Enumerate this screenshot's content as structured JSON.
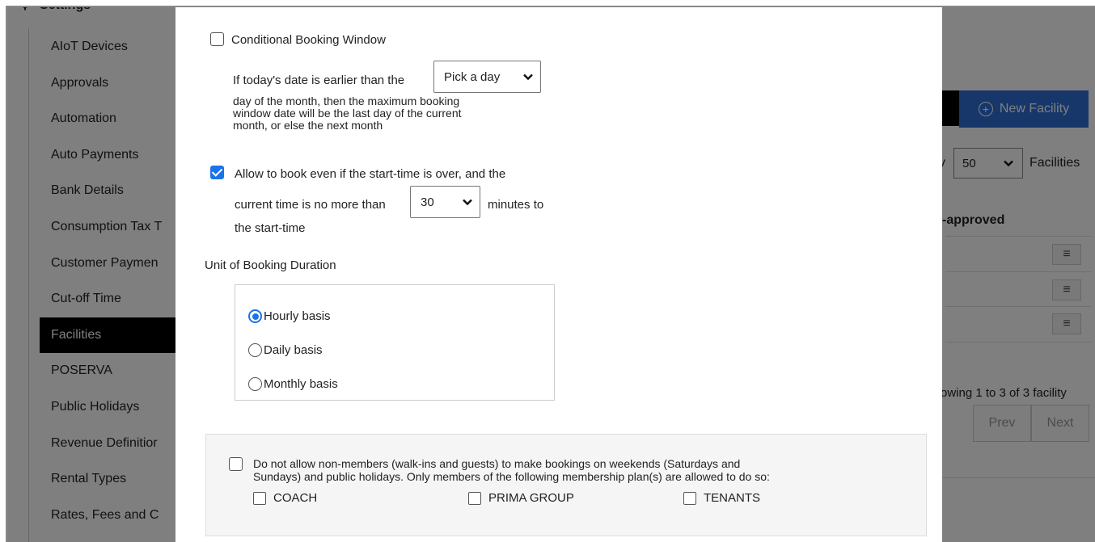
{
  "background": {
    "settings_title": "Settings",
    "sidebar": {
      "active_index": 8,
      "items": [
        {
          "label": "AIoT Devices"
        },
        {
          "label": "Approvals"
        },
        {
          "label": "Automation"
        },
        {
          "label": "Auto Payments"
        },
        {
          "label": "Bank Details"
        },
        {
          "label": "Consumption Tax T"
        },
        {
          "label": "Customer Paymen"
        },
        {
          "label": "Cut-off Time"
        },
        {
          "label": "Facilities"
        },
        {
          "label": "POSERVA"
        },
        {
          "label": "Public Holidays"
        },
        {
          "label": "Revenue Definitior"
        },
        {
          "label": "Rental Types"
        },
        {
          "label": "Rates, Fees and C"
        }
      ]
    },
    "toolbar": {
      "new_facility_label": "New Facility",
      "show_suffix": "v",
      "page_size": "50",
      "page_size_suffix": "Facilities"
    },
    "table": {
      "column_header": "-approved",
      "row_menu_icon": "≡",
      "rows": 3
    },
    "footer": {
      "showing_text": "owing 1 to 3 of 3 facility",
      "prev_label": "Prev",
      "next_label": "Next"
    }
  },
  "modal": {
    "conditional_window": {
      "label": "Conditional Booking Window",
      "checked": false,
      "text_before": "If today's date is earlier than the",
      "day_select_value": "Pick a day",
      "text_after_line1": "day of the month, then the maximum booking",
      "text_after_line2": "window date will be the last day of the current",
      "text_after_line3": "month, or else the next month"
    },
    "late_booking": {
      "checked": true,
      "line1": "Allow to book even if the start-time is over, and the",
      "line2_before": "current time is no more than",
      "minutes_value": "30",
      "line2_after": "minutes to",
      "line3": "the start-time"
    },
    "duration": {
      "heading": "Unit of Booking Duration",
      "options": [
        {
          "label": "Hourly basis",
          "selected": true
        },
        {
          "label": "Daily basis",
          "selected": false
        },
        {
          "label": "Monthly basis",
          "selected": false
        }
      ]
    },
    "non_members": {
      "checked": false,
      "line1": "Do not allow non-members (walk-ins and guests) to make bookings on weekends (Saturdays and",
      "line2": "Sundays) and public holidays. Only members of the following membership plan(s) are allowed to do so:",
      "plans": [
        {
          "label": "COACH",
          "checked": false
        },
        {
          "label": "PRIMA GROUP",
          "checked": false
        },
        {
          "label": "TENANTS",
          "checked": false
        }
      ]
    }
  },
  "colors": {
    "accent": "#1a73e8",
    "primary_button": "#2f6fd6",
    "active_nav": "#000000",
    "overlay": "rgba(0,0,0,0.5)"
  }
}
